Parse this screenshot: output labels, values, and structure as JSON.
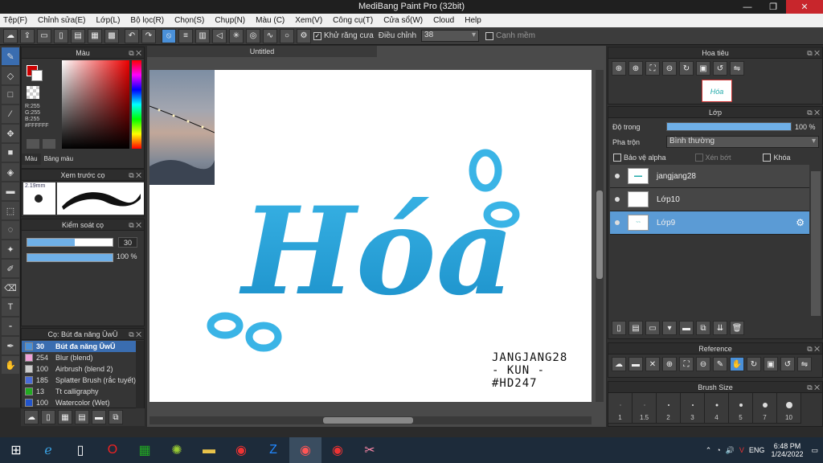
{
  "window": {
    "title": "MediBang Paint Pro (32bit)"
  },
  "menu": [
    "Tệp(F)",
    "Chỉnh sửa(E)",
    "Lớp(L)",
    "Bộ lọc(R)",
    "Chọn(S)",
    "Chụp(N)",
    "Màu (C)",
    "Xem(V)",
    "Công cụ(T)",
    "Cửa sổ(W)",
    "Cloud",
    "Help"
  ],
  "toolbar": {
    "antialias": "Khử răng cưa",
    "adjust_label": "Điều chỉnh",
    "adjust_value": "38",
    "snap": "Cạnh mềm"
  },
  "color_panel": {
    "title": "Màu",
    "r": "R:255",
    "g": "G:255",
    "b": "B:255",
    "hex": "#FFFFFF",
    "tab1": "Màu",
    "tab2": "Bảng màu"
  },
  "brush_preview": {
    "title": "Xem trước cọ",
    "size": "2.19mm"
  },
  "brush_control": {
    "title": "Kiểm soát cọ",
    "size": "30",
    "opacity": "100 %"
  },
  "brush_list": {
    "title": "Cọ: Bút đa năng ŪwŪ",
    "items": [
      {
        "size": "30",
        "name": "Bút đa năng ŪwŪ",
        "color": "#4a90d9"
      },
      {
        "size": "254",
        "name": "Blur (blend)",
        "color": "#f0a0d8"
      },
      {
        "size": "100",
        "name": "Airbrush (blend 2)",
        "color": "#cccccc"
      },
      {
        "size": "185",
        "name": "Splatter Brush (rắc tuyết)",
        "color": "#4a6cd9"
      },
      {
        "size": "13",
        "name": "Tt calligraphy",
        "color": "#22aa22"
      },
      {
        "size": "100",
        "name": "Watercolor (Wet)",
        "color": "#2255cc"
      }
    ]
  },
  "canvas": {
    "tab": "Untitled",
    "artwork_text": "Hóa",
    "signature": [
      "JANGJANG28",
      "- KUN -",
      "#HD247"
    ]
  },
  "navigator": {
    "title": "Hoa tiêu"
  },
  "layer_panel": {
    "title": "Lớp",
    "opacity_label": "Độ trong",
    "opacity_value": "100 %",
    "opacity_fraction": 1.0,
    "blend_label": "Pha trộn",
    "blend_value": "Bình thường",
    "protect_alpha": "Bảo vệ alpha",
    "clip": "Xén bớt",
    "lock": "Khóa",
    "layers": [
      {
        "name": "jangjang28"
      },
      {
        "name": "Lớp10"
      },
      {
        "name": "Lớp9"
      }
    ]
  },
  "reference": {
    "title": "Reference"
  },
  "brush_size": {
    "title": "Brush Size",
    "sizes": [
      "1",
      "1.5",
      "2",
      "3",
      "4",
      "5",
      "7",
      "10"
    ]
  },
  "taskbar": {
    "lang": "ENG",
    "time": "6:48 PM",
    "date": "1/24/2022"
  }
}
